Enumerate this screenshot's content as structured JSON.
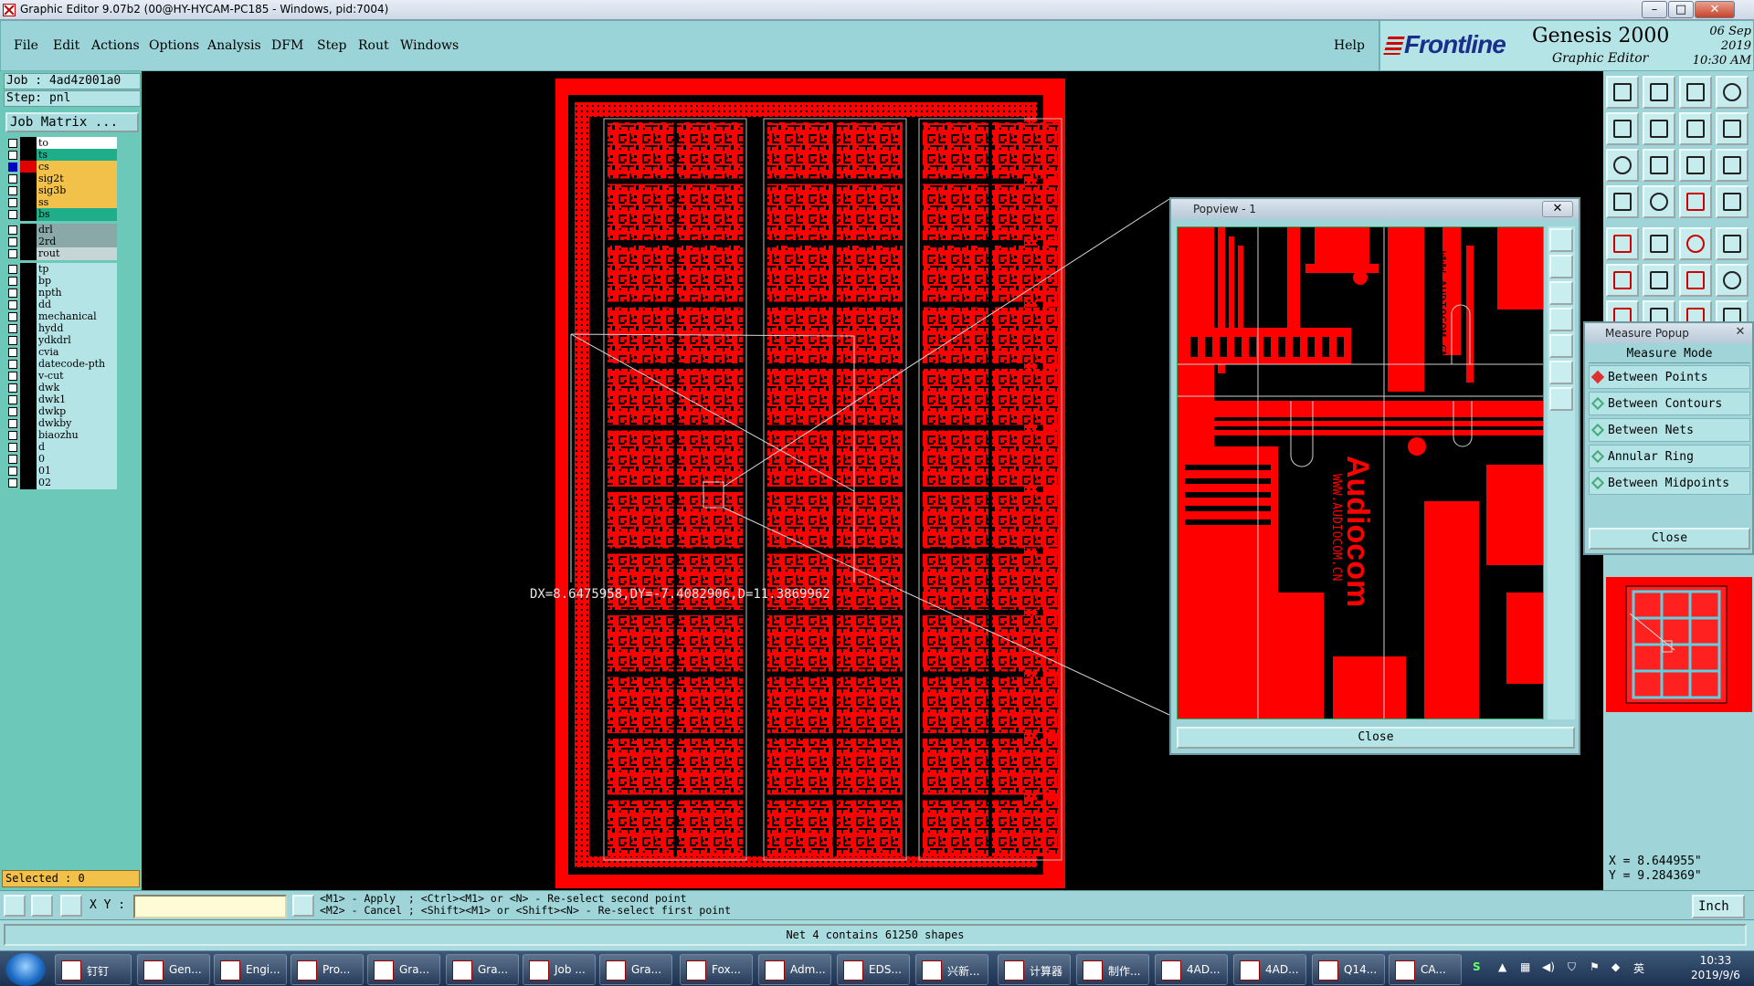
{
  "window": {
    "title": "Graphic Editor 9.07b2 (00@HY-HYCAM-PC185 - Windows, pid:7004)",
    "minimize": "–",
    "maximize": "□",
    "close": "✕"
  },
  "menu": {
    "items": [
      "File",
      "Edit",
      "Actions",
      "Options",
      "Analysis",
      "DFM",
      "Step",
      "Rout",
      "Windows"
    ],
    "help": "Help"
  },
  "brand": {
    "logo": "Frontline",
    "product": "Genesis 2000",
    "subtitle": "Graphic Editor",
    "date": "06 Sep 2019",
    "time": "10:30 AM"
  },
  "job": {
    "job_line": "Job : 4ad4z001a0",
    "step_line": "Step: pnl",
    "matrix_button": "Job Matrix ..."
  },
  "layers": [
    {
      "name": "to",
      "bg": "#ffffff",
      "color": "#000000",
      "on": false
    },
    {
      "name": "ts",
      "bg": "#1fae8a",
      "color": "#000000",
      "on": false
    },
    {
      "name": "cs",
      "bg": "#f2c14a",
      "color": "#e00000",
      "on": true
    },
    {
      "name": "sig2t",
      "bg": "#f2c14a",
      "color": "#000000",
      "on": false
    },
    {
      "name": "sig3b",
      "bg": "#f2c14a",
      "color": "#000000",
      "on": false
    },
    {
      "name": "ss",
      "bg": "#f2c14a",
      "color": "#000000",
      "on": false
    },
    {
      "name": "bs",
      "bg": "#1fae8a",
      "color": "#000000",
      "on": false
    },
    {
      "name": "drl",
      "bg": "#8aa8a8",
      "color": "#000000",
      "on": false
    },
    {
      "name": "2rd",
      "bg": "#8aa8a8",
      "color": "#000000",
      "on": false
    },
    {
      "name": "rout",
      "bg": "#c6d6d6",
      "color": "#000000",
      "on": false
    },
    {
      "name": "tp",
      "bg": "#b5e4e6",
      "color": "#000000",
      "on": false
    },
    {
      "name": "bp",
      "bg": "#b5e4e6",
      "color": "#000000",
      "on": false
    },
    {
      "name": "npth",
      "bg": "#b5e4e6",
      "color": "#000000",
      "on": false
    },
    {
      "name": "dd",
      "bg": "#b5e4e6",
      "color": "#000000",
      "on": false
    },
    {
      "name": "mechanical",
      "bg": "#b5e4e6",
      "color": "#000000",
      "on": false
    },
    {
      "name": "hydd",
      "bg": "#b5e4e6",
      "color": "#000000",
      "on": false
    },
    {
      "name": "ydkdrl",
      "bg": "#b5e4e6",
      "color": "#000000",
      "on": false
    },
    {
      "name": "cvia",
      "bg": "#b5e4e6",
      "color": "#000000",
      "on": false
    },
    {
      "name": "datecode-pth",
      "bg": "#b5e4e6",
      "color": "#000000",
      "on": false
    },
    {
      "name": "v-cut",
      "bg": "#b5e4e6",
      "color": "#000000",
      "on": false
    },
    {
      "name": "dwk",
      "bg": "#b5e4e6",
      "color": "#000000",
      "on": false
    },
    {
      "name": "dwk1",
      "bg": "#b5e4e6",
      "color": "#000000",
      "on": false
    },
    {
      "name": "dwkp",
      "bg": "#b5e4e6",
      "color": "#000000",
      "on": false
    },
    {
      "name": "dwkby",
      "bg": "#b5e4e6",
      "color": "#000000",
      "on": false
    },
    {
      "name": "biaozhu",
      "bg": "#b5e4e6",
      "color": "#000000",
      "on": false
    },
    {
      "name": "d",
      "bg": "#b5e4e6",
      "color": "#000000",
      "on": false
    },
    {
      "name": "0",
      "bg": "#b5e4e6",
      "color": "#000000",
      "on": false
    },
    {
      "name": "01",
      "bg": "#b5e4e6",
      "color": "#000000",
      "on": false
    },
    {
      "name": "02",
      "bg": "#b5e4e6",
      "color": "#000000",
      "on": false
    }
  ],
  "selected": "Selected : 0",
  "measure_readout": "DX=8.6475958,DY=-7.4082906,D=11.3869962",
  "popview": {
    "title": "Popview - 1",
    "close_label": "Close",
    "close_x": "✕",
    "board_text_1": "WWW.AUDIOCOM.CN",
    "board_text_2": "Audiocom"
  },
  "measure_popup": {
    "title": "Measure Popup",
    "mode_label": "Measure Mode",
    "options": [
      "Between Points",
      "Between Contours",
      "Between Nets",
      "Annular Ring",
      "Between Midpoints"
    ],
    "selected_option": "Between Points",
    "close_label": "Close"
  },
  "coords": {
    "x": "X = 8.644955\"",
    "y": "Y = 9.284369\""
  },
  "bottom": {
    "xy_label": "X Y :",
    "xy_value": "",
    "prompt_line1": "<M1> - Apply  ; <Ctrl><M1> or <N> - Re-select second point",
    "prompt_line2": "<M2> - Cancel ; <Shift><M1> or <Shift><N> - Re-select first point",
    "unit": "Inch"
  },
  "status_message": "Net 4 contains 61250 shapes",
  "taskbar": {
    "tasks": [
      "钉钉",
      "Gen...",
      "Engi...",
      "Pro...",
      "Gra...",
      "Gra...",
      "Job ...",
      "Gra...",
      "Fox...",
      "Adm...",
      "EDS...",
      "兴新...",
      "计算器",
      "制作...",
      "4AD...",
      "4AD...",
      "Q14...",
      "CA..."
    ],
    "ime": "英",
    "clock_time": "10:33",
    "clock_date": "2019/9/6"
  },
  "colors": {
    "copper": "#ff0000",
    "panel": "#9fd5d8",
    "layer_active": "#f2c14a"
  }
}
